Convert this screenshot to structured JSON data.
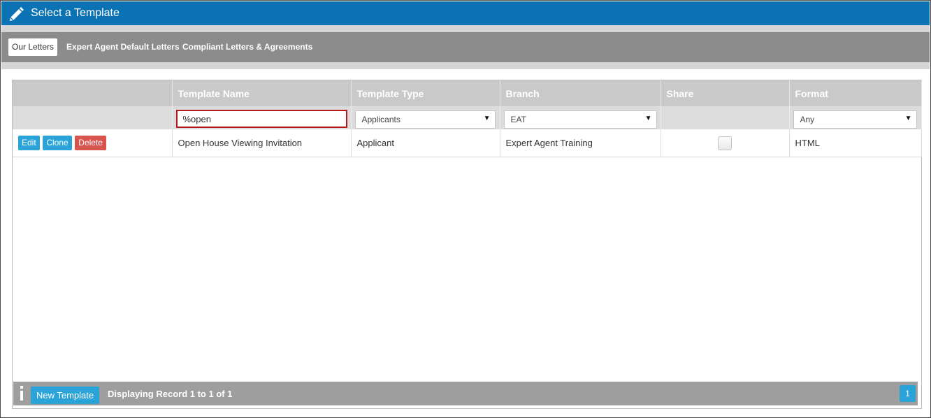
{
  "window": {
    "title": "Select a Template",
    "icon": "pencil-icon"
  },
  "tabs": [
    {
      "label": "Our Letters",
      "active": true
    },
    {
      "label": "Expert Agent Default Letters",
      "active": false
    },
    {
      "label": "Compliant Letters & Agreements",
      "active": false
    }
  ],
  "grid": {
    "columns": [
      "",
      "Template Name",
      "Template Type",
      "Branch",
      "Share",
      "Format"
    ],
    "filters": {
      "template_name": "%open",
      "template_type": "Applicants",
      "branch": "EAT",
      "format": "Any"
    },
    "rows": [
      {
        "actions": {
          "edit": "Edit",
          "clone": "Clone",
          "delete": "Delete"
        },
        "template_name": "Open House Viewing Invitation",
        "template_type": "Applicant",
        "branch": "Expert Agent Training",
        "share": false,
        "format": "HTML"
      }
    ]
  },
  "footer": {
    "new_template": "New Template",
    "status": "Displaying Record 1 to 1 of 1",
    "page": "1",
    "info_icon": "info-icon"
  },
  "colors": {
    "titlebar": "#0b73b4",
    "tabbar": "#8c8c8c",
    "header": "#c9c9c9",
    "button_blue": "#2aa3d8",
    "button_red": "#d9534f",
    "input_highlight": "#b51a1a"
  }
}
